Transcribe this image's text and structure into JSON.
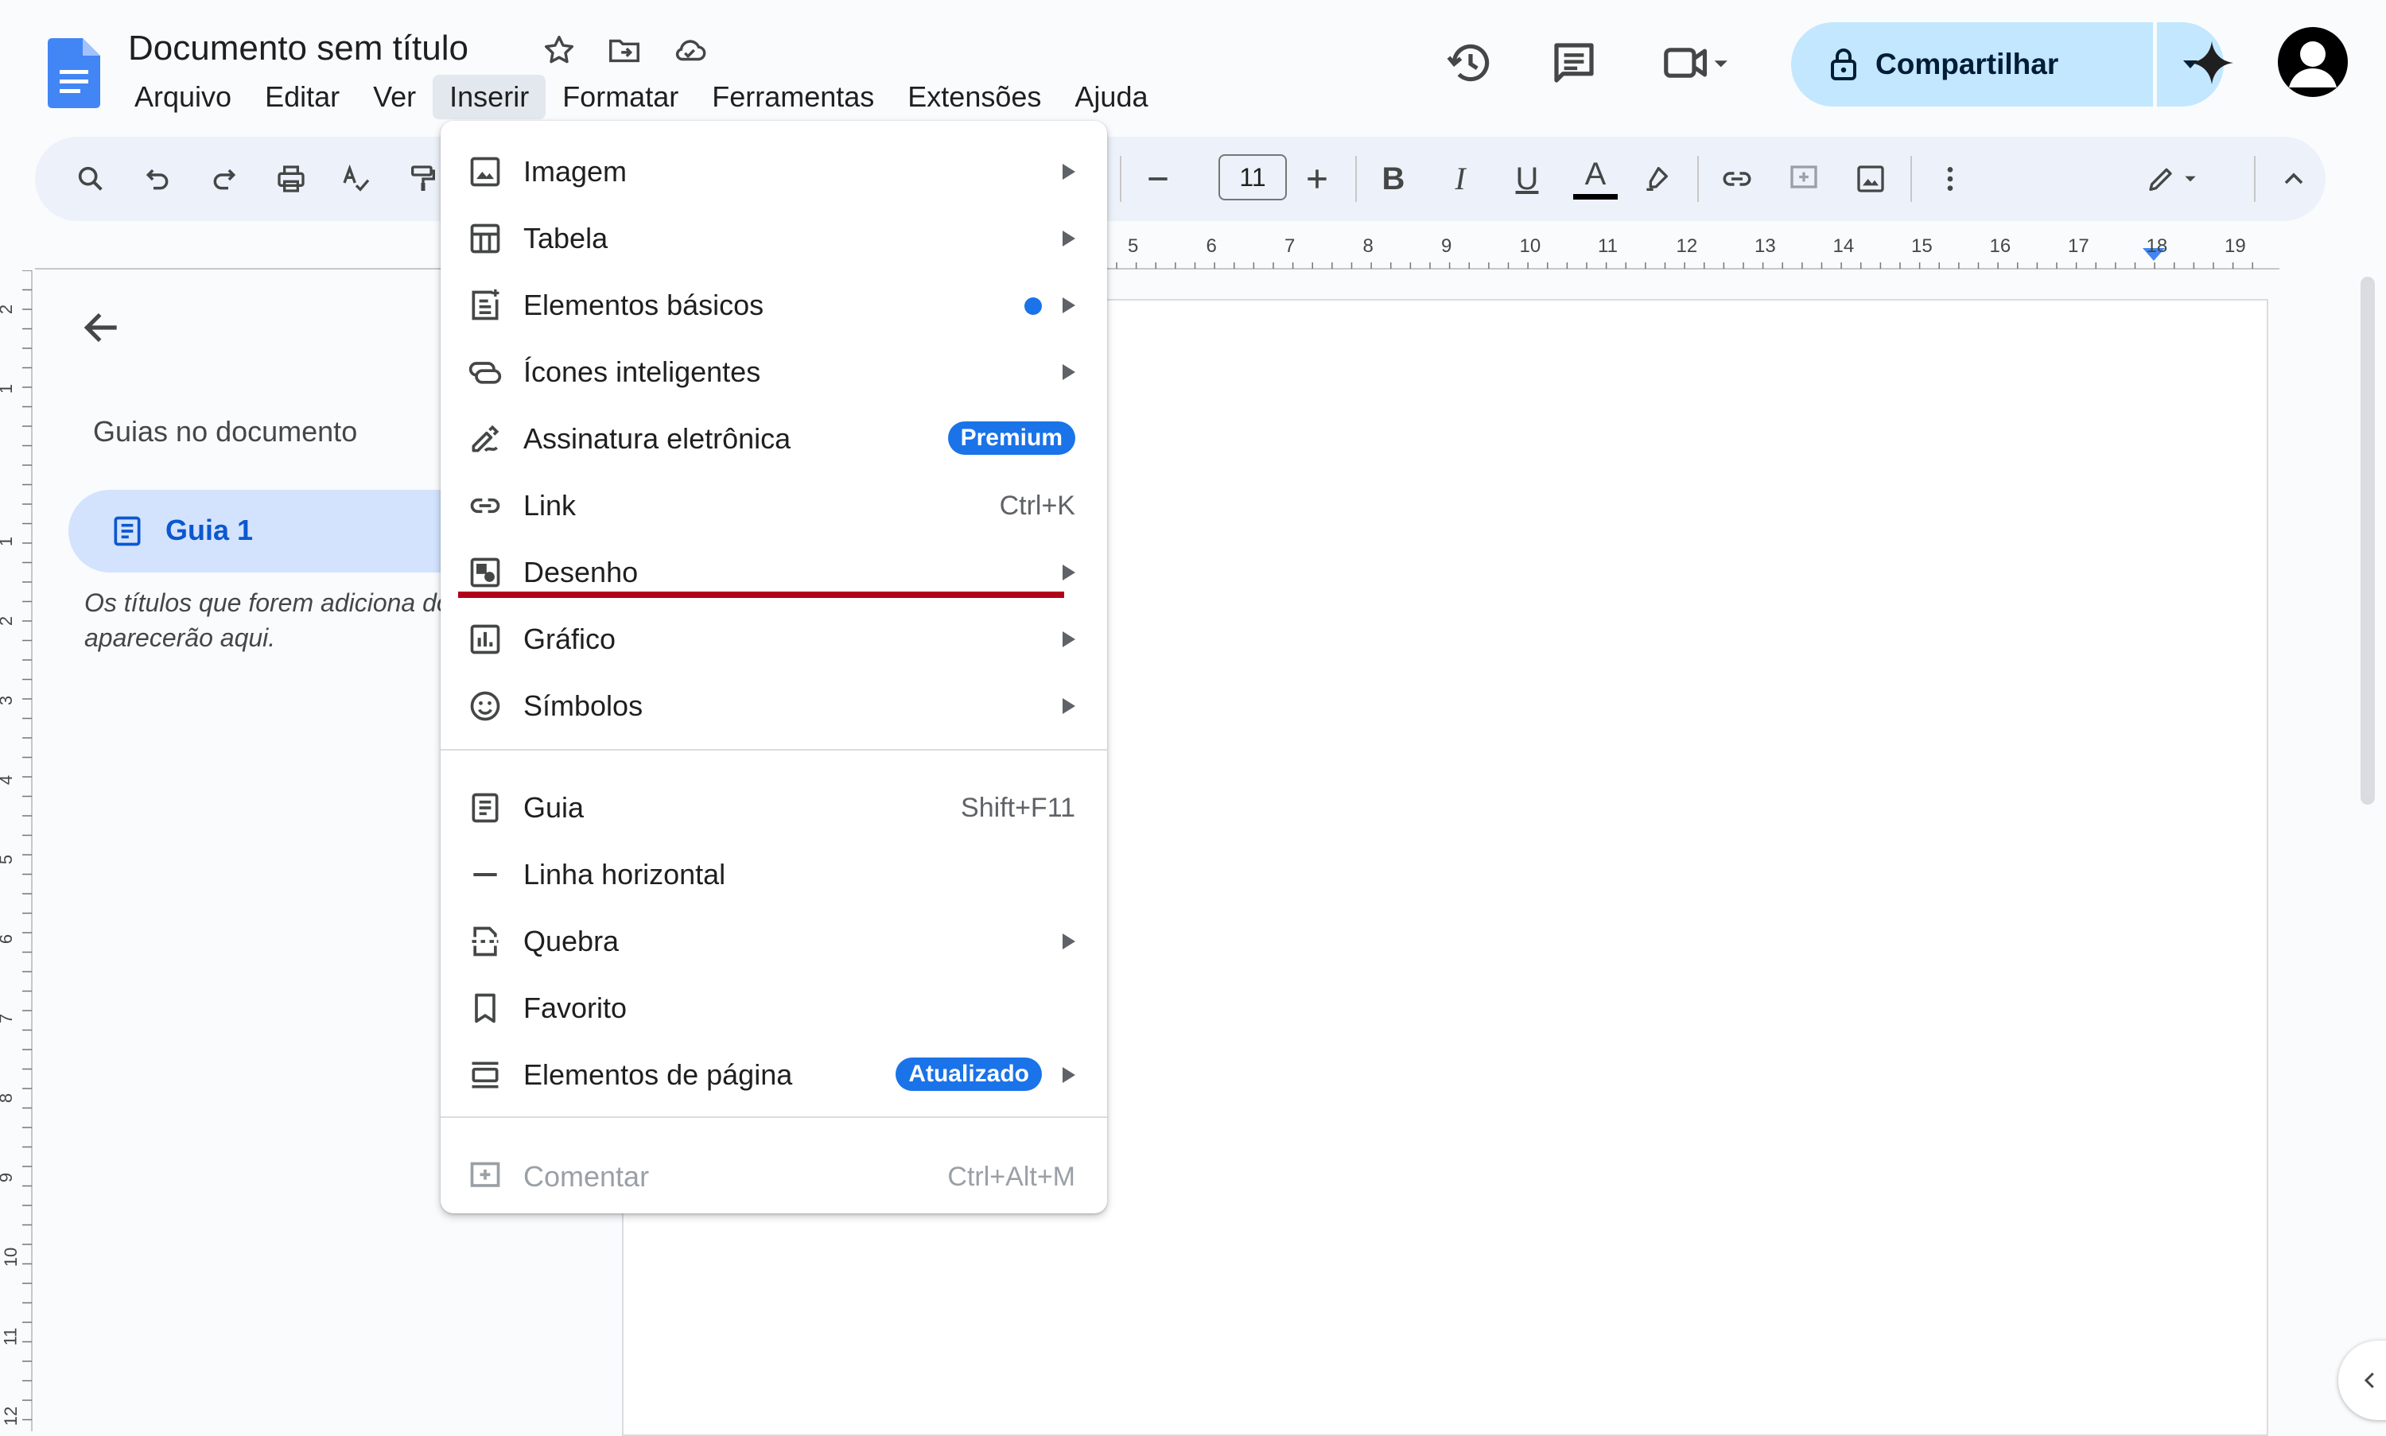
{
  "title": "Documento sem título",
  "menubar": [
    "Arquivo",
    "Editar",
    "Ver",
    "Inserir",
    "Formatar",
    "Ferramentas",
    "Extensões",
    "Ajuda"
  ],
  "active_menu": "Inserir",
  "share": {
    "label": "Compartilhar"
  },
  "toolbar": {
    "font_size": "11",
    "bold": "B",
    "italic": "I",
    "underline": "U",
    "text_color": "A"
  },
  "ruler": {
    "numbers": [
      "5",
      "6",
      "7",
      "8",
      "9",
      "10",
      "11",
      "12",
      "13",
      "14",
      "15",
      "16",
      "17",
      "18",
      "19"
    ]
  },
  "vruler": {
    "numbers": [
      "2",
      "1",
      "1",
      "2",
      "3",
      "4",
      "5",
      "6",
      "7",
      "8",
      "9",
      "10",
      "11",
      "12"
    ]
  },
  "outline": {
    "title": "Guias no documento",
    "item": "Guia 1",
    "hint": "Os títulos que forem adiciona documento aparecerão aqui."
  },
  "menu": {
    "items": [
      {
        "label": "Imagem"
      },
      {
        "label": "Tabela"
      },
      {
        "label": "Elementos básicos"
      },
      {
        "label": "Ícones inteligentes"
      },
      {
        "label": "Assinatura eletrônica",
        "badge": "Premium"
      },
      {
        "label": "Link",
        "shortcut": "Ctrl+K"
      },
      {
        "label": "Desenho"
      },
      {
        "label": "Gráfico"
      },
      {
        "label": "Símbolos"
      },
      {
        "label": "Guia",
        "shortcut": "Shift+F11"
      },
      {
        "label": "Linha horizontal"
      },
      {
        "label": "Quebra"
      },
      {
        "label": "Favorito"
      },
      {
        "label": "Elementos de página",
        "badge": "Atualizado"
      },
      {
        "label": "Comentar",
        "shortcut": "Ctrl+Alt+M"
      }
    ]
  },
  "colors": {
    "accent": "#1a73e8",
    "share_bg": "#c2e7ff",
    "toolbar_bg": "#edf2fa",
    "highlight": "#b3001b"
  }
}
